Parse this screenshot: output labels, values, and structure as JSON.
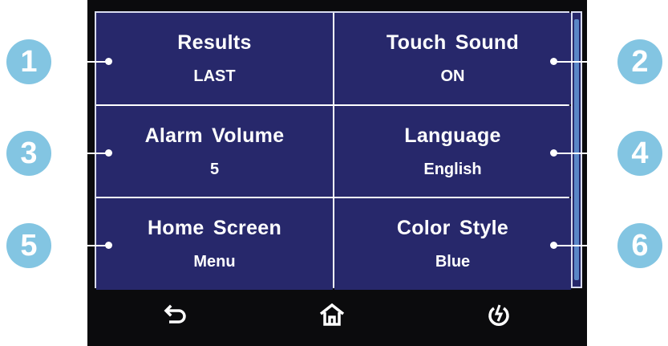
{
  "settings": [
    {
      "title": "Results",
      "value": "LAST",
      "callout": "1"
    },
    {
      "title": "Touch Sound",
      "value": "ON",
      "callout": "2"
    },
    {
      "title": "Alarm Volume",
      "value": "5",
      "callout": "3"
    },
    {
      "title": "Language",
      "value": "English",
      "callout": "4"
    },
    {
      "title": "Home Screen",
      "value": "Menu",
      "callout": "5"
    },
    {
      "title": "Color Style",
      "value": "Blue",
      "callout": "6"
    }
  ],
  "navbar": {
    "back_icon": "back-arrow-icon",
    "home_icon": "home-icon",
    "power_icon": "power-icon"
  },
  "colors": {
    "panel": "#27286b",
    "grid_lines": "#d9dcef",
    "callout": "#83c5e2",
    "scroll_thumb": "#5a87c7",
    "bezel": "#0b0b0d"
  }
}
